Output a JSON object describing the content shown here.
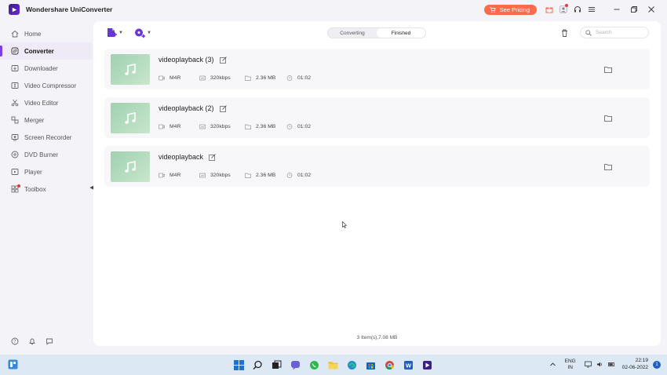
{
  "window": {
    "title": "Wondershare UniConverter",
    "pricing_label": "See Pricing"
  },
  "sidebar": {
    "items": [
      {
        "label": "Home",
        "icon": "home-icon"
      },
      {
        "label": "Converter",
        "icon": "converter-icon",
        "active": true
      },
      {
        "label": "Downloader",
        "icon": "download-icon"
      },
      {
        "label": "Video Compressor",
        "icon": "compress-icon"
      },
      {
        "label": "Video Editor",
        "icon": "scissors-icon"
      },
      {
        "label": "Merger",
        "icon": "merge-icon"
      },
      {
        "label": "Screen Recorder",
        "icon": "record-icon"
      },
      {
        "label": "DVD Burner",
        "icon": "disc-icon"
      },
      {
        "label": "Player",
        "icon": "play-icon"
      },
      {
        "label": "Toolbox",
        "icon": "grid-icon"
      }
    ]
  },
  "toolbar": {
    "tabs": [
      "Converting",
      "Finished"
    ],
    "selected_tab": "Finished",
    "search_placeholder": "Search"
  },
  "files": [
    {
      "name": "videoplayback (3)",
      "format": "M4R",
      "bitrate": "320kbps",
      "size": "2.36 MB",
      "duration": "01:02"
    },
    {
      "name": "videoplayback (2)",
      "format": "M4R",
      "bitrate": "320kbps",
      "size": "2.36 MB",
      "duration": "01:02"
    },
    {
      "name": "videoplayback",
      "format": "M4R",
      "bitrate": "320kbps",
      "size": "2.36 MB",
      "duration": "01:02"
    }
  ],
  "footer": {
    "summary": "3 Item(s),7.08 MB"
  },
  "taskbar": {
    "lang_line1": "ENG",
    "lang_line2": "IN",
    "time": "22:19",
    "date": "02-06-2022",
    "notification_count": "1"
  },
  "colors": {
    "accent": "#7b3fe4",
    "pricing": "#ff6a4d",
    "thumb": "#b4dcbf"
  }
}
